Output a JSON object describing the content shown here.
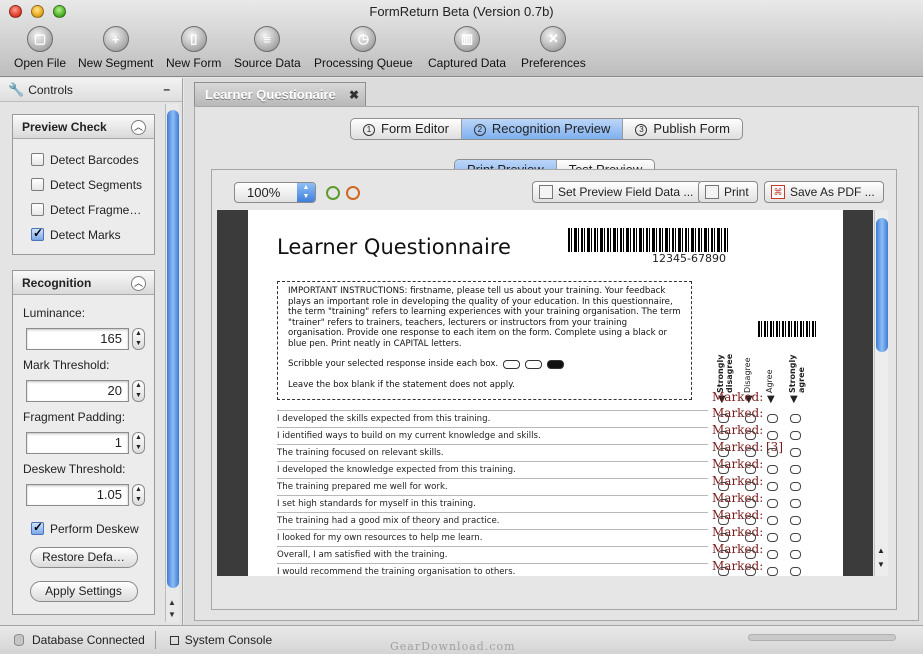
{
  "window": {
    "title": "FormReturn Beta (Version 0.7b)"
  },
  "toolbar": [
    {
      "label": "Open File",
      "icon": "open-file-icon",
      "glyph": "▢"
    },
    {
      "label": "New Segment",
      "icon": "new-segment-icon",
      "glyph": "+"
    },
    {
      "label": "New Form",
      "icon": "new-form-icon",
      "glyph": "▯"
    },
    {
      "label": "Source Data",
      "icon": "source-data-icon",
      "glyph": "≡"
    },
    {
      "label": "Processing Queue",
      "icon": "processing-queue-icon",
      "glyph": "◷"
    },
    {
      "label": "Captured Data",
      "icon": "captured-data-icon",
      "glyph": "▥"
    },
    {
      "label": "Preferences",
      "icon": "preferences-icon",
      "glyph": "✕"
    }
  ],
  "controls": {
    "title": "Controls",
    "minimize": "–",
    "preview_check": {
      "title": "Preview Check",
      "items": [
        {
          "label": "Detect Barcodes",
          "checked": false
        },
        {
          "label": "Detect Segments",
          "checked": false
        },
        {
          "label": "Detect Fragme…",
          "checked": false
        },
        {
          "label": "Detect Marks",
          "checked": true
        }
      ]
    },
    "recognition": {
      "title": "Recognition",
      "luminance_label": "Luminance:",
      "luminance_value": "165",
      "mark_threshold_label": "Mark Threshold:",
      "mark_threshold_value": "20",
      "fragment_padding_label": "Fragment Padding:",
      "fragment_padding_value": "1",
      "deskew_threshold_label": "Deskew Threshold:",
      "deskew_threshold_value": "1.05",
      "perform_deskew_label": "Perform Deskew",
      "perform_deskew_checked": true,
      "restore_defaults_label": "Restore Defa…",
      "apply_settings_label": "Apply Settings"
    }
  },
  "document_tab": {
    "label": "Learner Questionaire",
    "close": "✖"
  },
  "mode_tabs": [
    {
      "num": "1",
      "label": "Form Editor",
      "active": false
    },
    {
      "num": "2",
      "label": "Recognition Preview",
      "active": true
    },
    {
      "num": "3",
      "label": "Publish Form",
      "active": false
    }
  ],
  "preview_tabs": [
    {
      "label": "Print Preview",
      "active": true
    },
    {
      "label": "Test Preview",
      "active": false
    }
  ],
  "preview_toolbar": {
    "zoom": "100%",
    "set_preview_label": "Set Preview Field Data ...",
    "print_label": "Print",
    "save_pdf_label": "Save As PDF ..."
  },
  "form": {
    "title": "Learner Questionnaire",
    "barcode_number": "12345-67890",
    "instructions": "IMPORTANT INSTRUCTIONS: firstname, please tell us about your training. Your feedback plays an important role in developing the quality of your education. In this questionnaire, the term \"training\" refers to learning experiences with your training organisation. The term \"trainer\" refers to trainers, teachers, lecturers or instructors from your training organisation. Provide one response to each item on the form. Complete using a black or blue pen. Print neatly in CAPITAL letters.",
    "scribble_text": "Scribble your selected response inside each box.",
    "blank_text": "Leave the box blank if the statement does not apply.",
    "columns": [
      "Strongly disagree",
      "Disagree",
      "Agree",
      "Strongly agree"
    ],
    "marked_label": "Marked:",
    "marked_value_row3": "[3]",
    "questions": [
      "I developed the skills expected from this training.",
      "I identified ways to build on my current knowledge and skills.",
      "The training focused on relevant skills.",
      "I developed the knowledge expected from this training.",
      "The training prepared me well for work.",
      "I set high standards for myself in this training.",
      "The training had a good mix of theory and practice.",
      "I looked for my own resources to help me learn.",
      "Overall, I am satisfied with the training.",
      "I would recommend the training organisation to others."
    ]
  },
  "status_bar": {
    "database": "Database Connected",
    "console": "System Console",
    "watermark": "GearDownload.com"
  },
  "colors": {
    "accent_blue": "#7fb0ef",
    "marked_red": "#7a1c1c"
  }
}
